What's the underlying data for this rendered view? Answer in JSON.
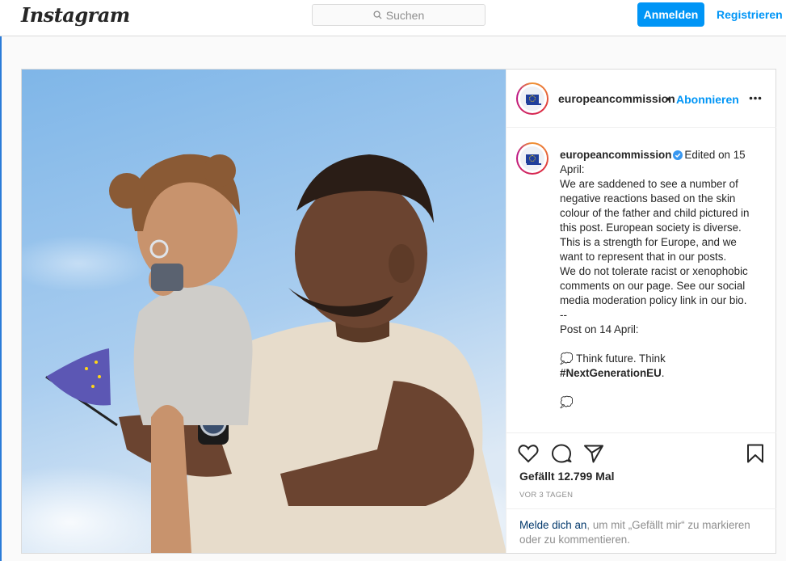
{
  "topbar": {
    "logo": "Instagram",
    "search_placeholder": "Suchen",
    "login_label": "Anmelden",
    "register_label": "Registrieren"
  },
  "post": {
    "username": "europeancommission",
    "header_separator": "•",
    "follow_label": "Abonnieren",
    "caption": {
      "username": "europeancommission",
      "body": "Edited on 15 April:\nWe are saddened to see a number of negative reactions based on the skin colour of the father and child pictured in this post. European society is diverse. This is a strength for Europe, and we want to represent that in our posts.\nWe do not tolerate racist or xenophobic comments on our page. See our social media moderation policy link in our bio.\n--\nPost on 14 April:\n\n💭 Think future. Think ",
      "hashtag": "#NextGenerationEU",
      "after_hashtag": ".",
      "cut_line": "\n\n💭 "
    },
    "likes": "Gefällt 12.799 Mal",
    "time": "VOR 3 TAGEN",
    "login_prompt": {
      "link": "Melde dich an",
      "rest": ", um mit „Gefällt mir“ zu markieren oder zu kommentieren."
    }
  },
  "icons": {
    "search": "search-icon",
    "more": "more-options-icon",
    "verified": "verified-badge-icon",
    "like": "heart-icon",
    "comment": "comment-icon",
    "share": "share-icon",
    "save": "bookmark-icon"
  },
  "colors": {
    "accent": "#0095f6",
    "text": "#262626",
    "muted": "#8e8e8e",
    "link_dark": "#00376b",
    "eu_blue": "#1f3f9c",
    "eu_yellow": "#ffd617"
  }
}
